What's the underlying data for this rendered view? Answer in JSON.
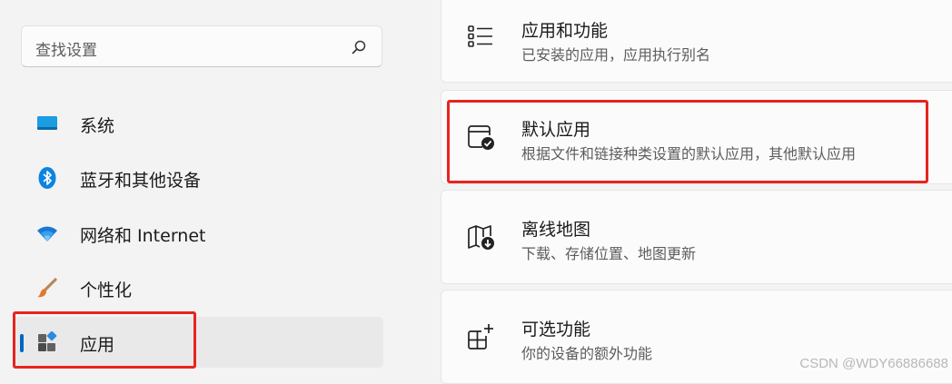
{
  "search": {
    "placeholder": "查找设置",
    "icon": "search-icon"
  },
  "sidebar": {
    "items": [
      {
        "label": "系统",
        "icon": "system-icon",
        "selected": false
      },
      {
        "label": "蓝牙和其他设备",
        "icon": "bluetooth-icon",
        "selected": false
      },
      {
        "label": "网络和 Internet",
        "icon": "wifi-icon",
        "selected": false
      },
      {
        "label": "个性化",
        "icon": "brush-icon",
        "selected": false
      },
      {
        "label": "应用",
        "icon": "apps-icon",
        "selected": true
      }
    ]
  },
  "main": {
    "cards": [
      {
        "title": "应用和功能",
        "subtitle": "已安装的应用，应用执行别名",
        "icon": "list-icon"
      },
      {
        "title": "默认应用",
        "subtitle": "根据文件和链接种类设置的默认应用，其他默认应用",
        "icon": "default-apps-icon"
      },
      {
        "title": "离线地图",
        "subtitle": "下载、存储位置、地图更新",
        "icon": "offline-map-icon"
      },
      {
        "title": "可选功能",
        "subtitle": "你的设备的额外功能",
        "icon": "optional-features-icon"
      }
    ]
  },
  "colors": {
    "accent": "#0067c0",
    "highlight": "#e8231e",
    "background": "#f3f3f3"
  },
  "watermark": "CSDN @WDY66886688"
}
